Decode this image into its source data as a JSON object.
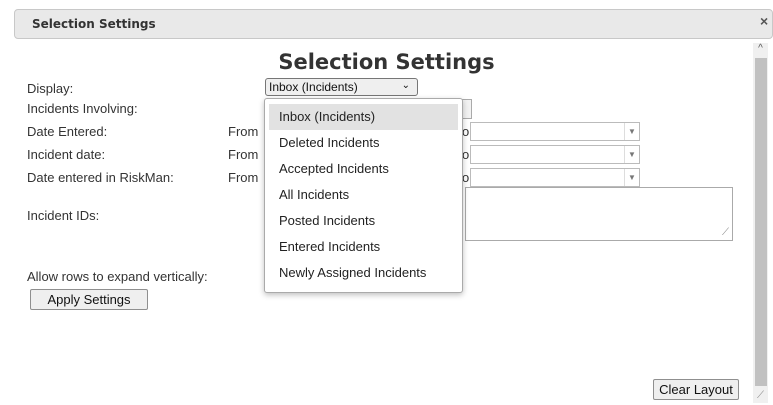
{
  "window": {
    "title": "Selection Settings",
    "close_label": "×"
  },
  "heading": "Selection Settings",
  "labels": {
    "display": "Display:",
    "incidents_involving": "Incidents Involving:",
    "date_entered": "Date Entered:",
    "incident_date": "Incident date:",
    "date_entered_riskman": "Date entered in RiskMan:",
    "incident_ids": "Incident IDs:",
    "allow_rows": "Allow rows to expand vertically:"
  },
  "from_label": "From",
  "to_fragment": "o",
  "display_select": {
    "value": "Inbox (Incidents)"
  },
  "dropdown_options": [
    "Inbox (Incidents)",
    "Deleted Incidents",
    "Accepted Incidents",
    "All Incidents",
    "Posted Incidents",
    "Entered Incidents",
    "Newly Assigned Incidents"
  ],
  "buttons": {
    "apply": "Apply Settings",
    "clear_layout": "Clear Layout"
  },
  "icons": {
    "close": "close-icon",
    "chevron": "chevron-down-icon",
    "scroll_up": "chevron-up-icon",
    "resize": "resize-grip-icon"
  }
}
